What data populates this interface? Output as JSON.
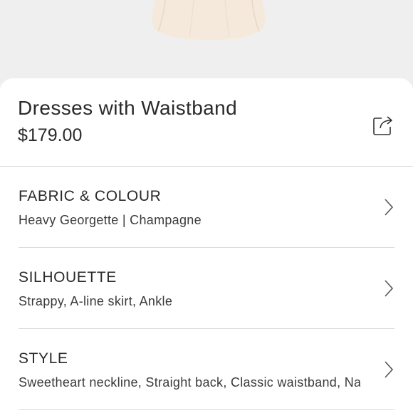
{
  "product": {
    "title": "Dresses with Waistband",
    "price": "$179.00"
  },
  "icons": {
    "share": "share-icon",
    "chevron": "chevron-right-icon"
  },
  "details": [
    {
      "label": "FABRIC & COLOUR",
      "value": "Heavy Georgette | Champagne"
    },
    {
      "label": "SILHOUETTE",
      "value": "Strappy, A-line skirt, Ankle"
    },
    {
      "label": "STYLE",
      "value": "Sweetheart neckline, Straight back, Classic waistband, Nar..."
    }
  ],
  "colors": {
    "dress": "#f5e9dc",
    "background": "#efefef",
    "sheet": "#ffffff",
    "divider": "#d9d9d9"
  }
}
